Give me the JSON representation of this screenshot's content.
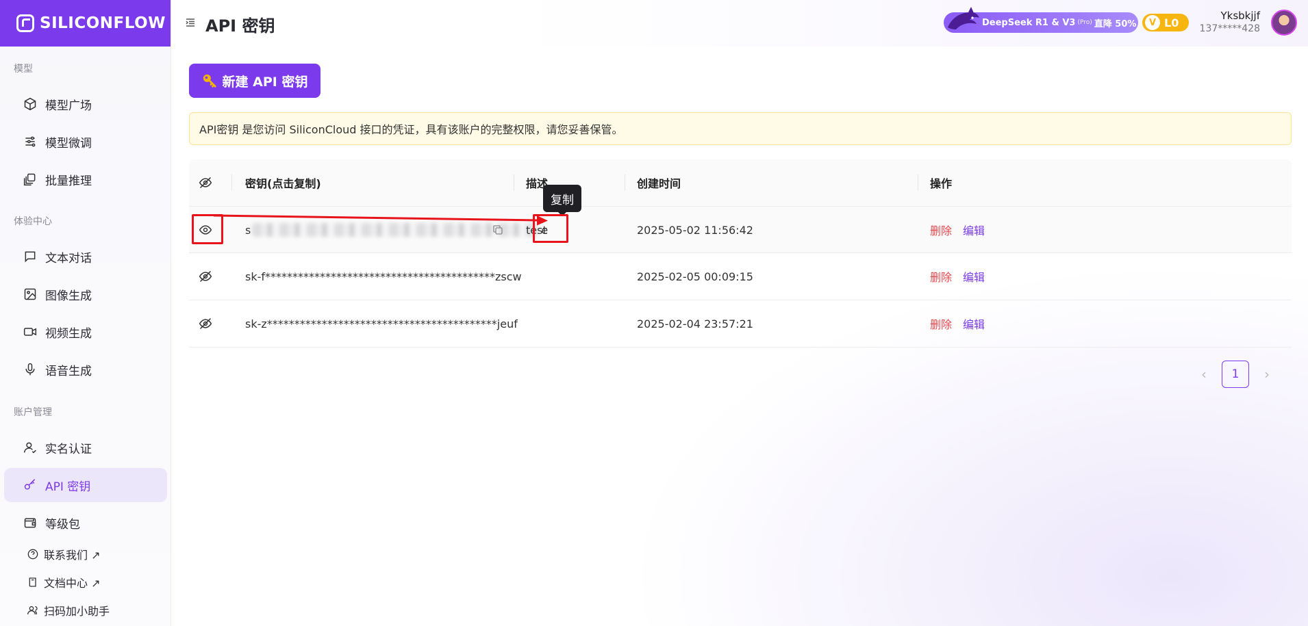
{
  "brand": {
    "name": "SILICONFLOW"
  },
  "sidebar": {
    "sections": [
      {
        "label": "模型"
      },
      {
        "label": "体验中心"
      },
      {
        "label": "账户管理"
      }
    ],
    "items": [
      {
        "label": "模型广场",
        "icon": "cube-icon"
      },
      {
        "label": "模型微调",
        "icon": "sliders-icon"
      },
      {
        "label": "批量推理",
        "icon": "layers-icon"
      },
      {
        "label": "文本对话",
        "icon": "chat-icon"
      },
      {
        "label": "图像生成",
        "icon": "image-icon"
      },
      {
        "label": "视频生成",
        "icon": "video-icon"
      },
      {
        "label": "语音生成",
        "icon": "mic-icon"
      },
      {
        "label": "实名认证",
        "icon": "user-check-icon"
      },
      {
        "label": "API 密钥",
        "icon": "key-icon"
      },
      {
        "label": "等级包",
        "icon": "wallet-icon"
      },
      {
        "label": "联系我们 ↗",
        "icon": "help-circle-icon"
      },
      {
        "label": "文档中心 ↗",
        "icon": "book-icon"
      },
      {
        "label": "扫码加小助手",
        "icon": "users-icon"
      }
    ]
  },
  "header": {
    "title": "API 密钥",
    "promo": {
      "text": "DeepSeek R1 & V3",
      "pro": "(Pro)",
      "discount": "直降 50%"
    },
    "vip": {
      "badge": "V",
      "level": "L0"
    },
    "user": {
      "name": "Yksbkjjf",
      "phone": "137*****428"
    }
  },
  "main": {
    "new_key_label": "新建 API 密钥",
    "notice": "API密钥 是您访问 SiliconCloud 接口的凭证，具有该账户的完整权限，请您妥善保管。",
    "table": {
      "headers": {
        "key": "密钥(点击复制)",
        "desc": "描述",
        "created": "创建时间",
        "actions": "操作"
      },
      "rows": [
        {
          "key_prefix": "s",
          "key_suffix": "e",
          "desc": "test",
          "created": "2025-05-02 11:56:42",
          "delete": "删除",
          "edit": "编辑"
        },
        {
          "key": "sk-f******************************************zscw",
          "desc": "",
          "created": "2025-02-05 00:09:15",
          "delete": "删除",
          "edit": "编辑"
        },
        {
          "key": "sk-z******************************************jeuf",
          "desc": "",
          "created": "2025-02-04 23:57:21",
          "delete": "删除",
          "edit": "编辑"
        }
      ]
    },
    "tooltip": "复制",
    "pagination": {
      "current": "1"
    }
  },
  "colors": {
    "accent": "#7c3aed",
    "danger": "#e5484d",
    "annotation": "#e8141b"
  }
}
